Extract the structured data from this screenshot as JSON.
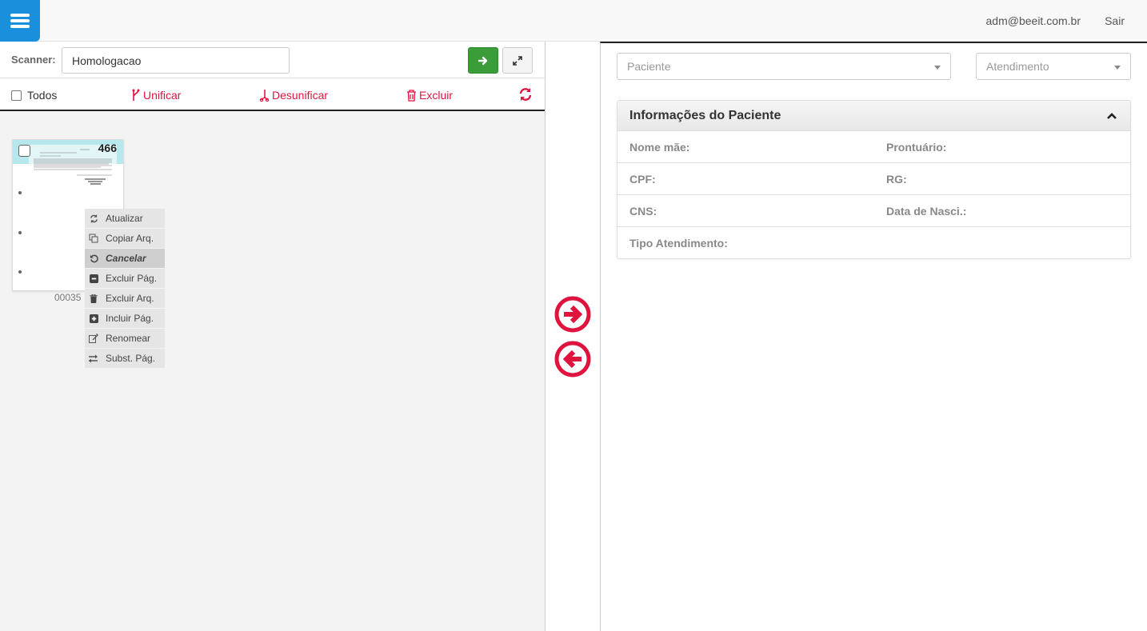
{
  "header": {
    "user_email": "adm@beeit.com.br",
    "logout_label": "Sair"
  },
  "scanner": {
    "label": "Scanner:",
    "value": "Homologacao"
  },
  "actions": {
    "select_all_label": "Todos",
    "unificar_label": "Unificar",
    "desunificar_label": "Desunificar",
    "excluir_label": "Excluir"
  },
  "thumbnail": {
    "number": "466",
    "caption": "00035"
  },
  "context_menu": {
    "items": [
      {
        "label": "Atualizar",
        "icon": "refresh-icon"
      },
      {
        "label": "Copiar Arq.",
        "icon": "copy-icon"
      },
      {
        "label": "Cancelar",
        "icon": "undo-icon"
      },
      {
        "label": "Excluir Pág.",
        "icon": "minus-square-icon"
      },
      {
        "label": "Excluir Arq.",
        "icon": "trash-icon"
      },
      {
        "label": "Incluir Pág.",
        "icon": "plus-square-icon"
      },
      {
        "label": "Renomear",
        "icon": "edit-icon"
      },
      {
        "label": "Subst. Pág.",
        "icon": "exchange-icon"
      }
    ],
    "active_item": "Cancelar"
  },
  "right": {
    "paciente_placeholder": "Paciente",
    "atendimento_placeholder": "Atendimento"
  },
  "patient_info": {
    "title": "Informações do Paciente",
    "fields": {
      "nome_mae": "Nome mãe:",
      "prontuario": "Prontuário:",
      "cpf": "CPF:",
      "rg": "RG:",
      "cns": "CNS:",
      "data_nasc": "Data de Nasci.:",
      "tipo_atendimento": "Tipo Atendimento:"
    }
  },
  "colors": {
    "accent_blue": "#1a8fdc",
    "accent_red": "#e0133f",
    "go_green": "#3a9d3a",
    "thumb_header": "#b6e7ec"
  }
}
